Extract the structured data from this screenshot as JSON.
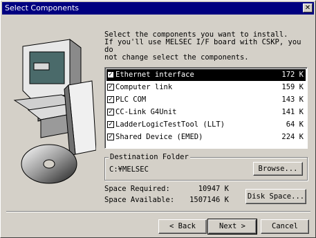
{
  "window": {
    "title": "Select Components",
    "close_glyph": "✕"
  },
  "instructions": "Select the components you want to install.\nIf you'll use MELSEC I/F board with CSKP, you do\nnot change select the components.",
  "components": [
    {
      "name": "Ethernet interface",
      "size": "172 K",
      "checked": true,
      "selected": true
    },
    {
      "name": "Computer link",
      "size": "159 K",
      "checked": true,
      "selected": false
    },
    {
      "name": "PLC COM",
      "size": "143 K",
      "checked": true,
      "selected": false
    },
    {
      "name": "CC-Link G4Unit",
      "size": "141 K",
      "checked": true,
      "selected": false
    },
    {
      "name": "LadderLogicTestTool (LLT)",
      "size": "64 K",
      "checked": true,
      "selected": false
    },
    {
      "name": "Shared Device (EMED)",
      "size": "224 K",
      "checked": true,
      "selected": false
    }
  ],
  "destination": {
    "label": "Destination Folder",
    "path": "C:¥MELSEC",
    "browse_label": "Browse..."
  },
  "space": {
    "required_label": "Space Required:",
    "required_value": "10947 K",
    "available_label": "Space Available:",
    "available_value": "1507146 K",
    "disk_space_label": "Disk Space..."
  },
  "buttons": {
    "back": "< Back",
    "next": "Next >",
    "cancel": "Cancel"
  },
  "colors": {
    "title_bar": "#000080",
    "face": "#d4d0c8",
    "selection": "#000000"
  },
  "icons": {
    "close": "close-icon",
    "checkbox": "checkmark-icon"
  }
}
